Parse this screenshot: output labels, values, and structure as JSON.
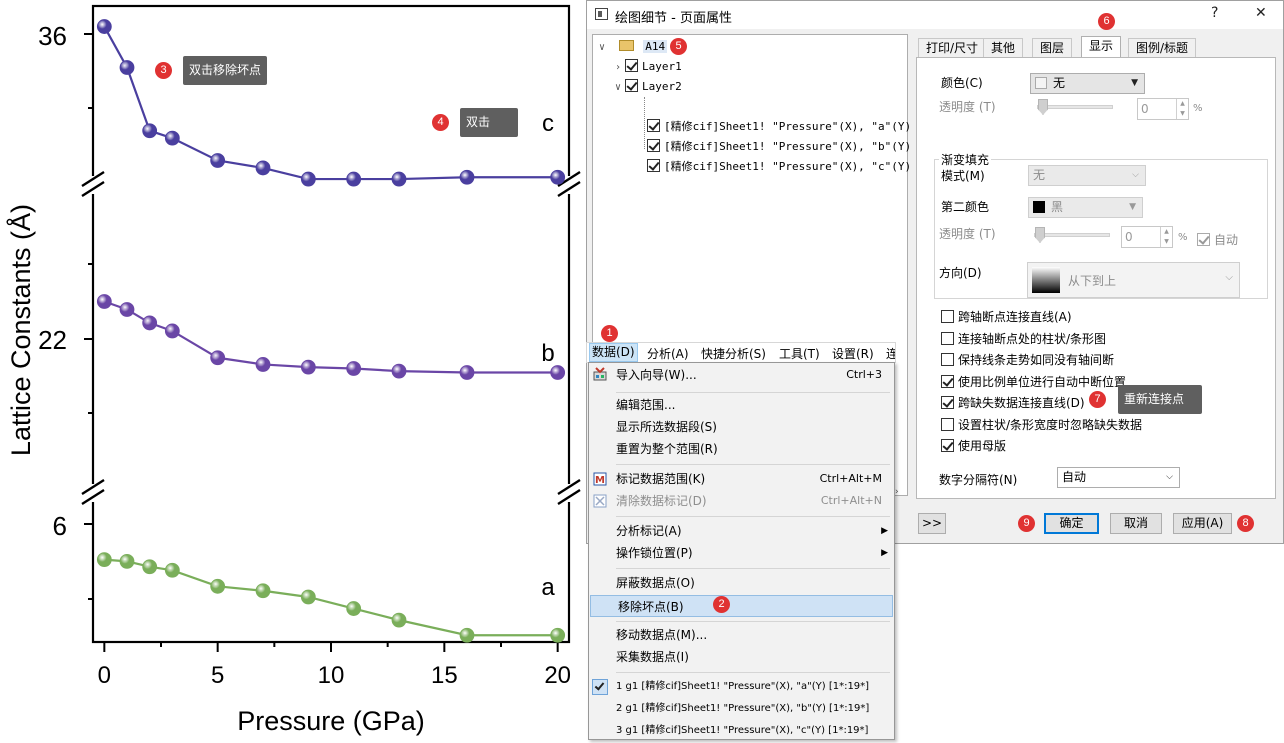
{
  "chart_data": {
    "type": "line",
    "xlabel": "Pressure (GPa)",
    "ylabel": "Lattice Constants (Å)",
    "x_ticks": [
      "0",
      "5",
      "10",
      "15",
      "20"
    ],
    "y_ticks": [
      "36",
      "22",
      "6"
    ],
    "xlim": [
      -0.5,
      20.5
    ],
    "broken_y_axis": true,
    "panels": [
      {
        "series": "c",
        "color": "#4a3f9f",
        "ylim_label_tick": "36"
      },
      {
        "series": "b",
        "color": "#6a46a6",
        "ylim_label_tick": "22"
      },
      {
        "series": "a",
        "color": "#7aae5a",
        "ylim_label_tick": "6"
      }
    ],
    "series": [
      {
        "name": "c",
        "x": [
          0,
          1,
          2,
          3,
          5,
          7,
          9,
          11,
          13,
          16,
          20
        ],
        "values": [
          36.2,
          35.1,
          33.4,
          33.2,
          32.6,
          32.4,
          32.1,
          32.1,
          32.1,
          32.15,
          32.15
        ]
      },
      {
        "name": "b",
        "x": [
          0,
          1,
          2,
          3,
          5,
          7,
          9,
          11,
          13,
          16,
          20
        ],
        "values": [
          24.8,
          24.2,
          23.2,
          22.6,
          20.6,
          20.1,
          19.9,
          19.8,
          19.6,
          19.5,
          19.5
        ]
      },
      {
        "name": "a",
        "x": [
          0,
          1,
          2,
          3,
          5,
          7,
          9,
          11,
          13,
          16,
          20
        ],
        "values": [
          5.6,
          5.58,
          5.52,
          5.48,
          5.3,
          5.25,
          5.18,
          5.05,
          4.92,
          4.75,
          4.75
        ]
      }
    ],
    "grid": false,
    "legend": "none"
  },
  "annotations": {
    "b1": "1",
    "b2": "2",
    "b3": "3",
    "b4": "4",
    "b5": "5",
    "b6": "6",
    "b7": "7",
    "b8": "8",
    "b9": "9",
    "tip_remove_bad": "双击移除坏点",
    "tip_dblclick": "双击",
    "tip_reconnect": "重新连接点"
  },
  "dialog": {
    "title": "绘图细节 - 页面属性",
    "help": "?",
    "close": "✕",
    "tree": {
      "root": "A14",
      "layer1": "Layer1",
      "layer2": "Layer2",
      "plots": [
        "[精修cif]Sheet1! \"Pressure\"(X), \"a\"(Y)",
        "[精修cif]Sheet1! \"Pressure\"(X), \"b\"(Y)",
        "[精修cif]Sheet1! \"Pressure\"(X), \"c\"(Y)"
      ]
    },
    "tabs": [
      "打印/尺寸",
      "其他",
      "图层",
      "显示",
      "图例/标题"
    ],
    "active_tab": "显示",
    "color_label": "颜色(C)",
    "color_value": "无",
    "transparency_label": "透明度 (T)",
    "transparency_value": "0",
    "percent": "%",
    "gradient_group": "渐变填充",
    "mode_label": "模式(M)",
    "mode_value": "无",
    "second_color_label": "第二颜色",
    "second_color_value": "黑",
    "transparency2_label": "透明度 (T)",
    "transparency2_value": "0",
    "auto_label": "自动",
    "direction_label": "方向(D)",
    "direction_value": "从下到上",
    "options": [
      {
        "label": "跨轴断点连接直线(A)",
        "checked": false
      },
      {
        "label": "连接轴断点处的柱状/条形图",
        "checked": false
      },
      {
        "label": "保持线条走势如同没有轴间断",
        "checked": false
      },
      {
        "label": "使用比例单位进行自动中断位置",
        "checked": true
      },
      {
        "label": "跨缺失数据连接直线(D)",
        "checked": true
      },
      {
        "label": "设置柱状/条形宽度时忽略缺失数据",
        "checked": false
      },
      {
        "label": "使用母版",
        "checked": true
      }
    ],
    "digit_sep_label": "数字分隔符(N)",
    "digit_sep_value": "自动",
    "btn_expand": ">>",
    "btn_ok": "确定",
    "btn_cancel": "取消",
    "btn_apply": "应用(A)"
  },
  "menubar": [
    "数据(D)",
    "分析(A)",
    "快捷分析(S)",
    "工具(T)",
    "设置(R)",
    "连"
  ],
  "menu": {
    "items": [
      {
        "label": "导入向导(W)...",
        "shortcut": "Ctrl+3"
      },
      {
        "label": "编辑范围..."
      },
      {
        "label": "显示所选数据段(S)"
      },
      {
        "label": "重置为整个范围(R)"
      },
      {
        "label": "标记数据范围(K)",
        "shortcut": "Ctrl+Alt+M"
      },
      {
        "label": "清除数据标记(D)",
        "shortcut": "Ctrl+Alt+N"
      },
      {
        "label": "分析标记(A)"
      },
      {
        "label": "操作锁位置(P)"
      },
      {
        "label": "屏蔽数据点(O)"
      },
      {
        "label": "移除坏点(B)"
      },
      {
        "label": "移动数据点(M)..."
      },
      {
        "label": "采集数据点(I)"
      },
      {
        "label": "1 g1 [精修cif]Sheet1! \"Pressure\"(X), \"a\"(Y) [1*:19*]"
      },
      {
        "label": "2 g1 [精修cif]Sheet1! \"Pressure\"(X), \"b\"(Y) [1*:19*]"
      },
      {
        "label": "3 g1 [精修cif]Sheet1! \"Pressure\"(X), \"c\"(Y) [1*:19*]"
      }
    ]
  }
}
